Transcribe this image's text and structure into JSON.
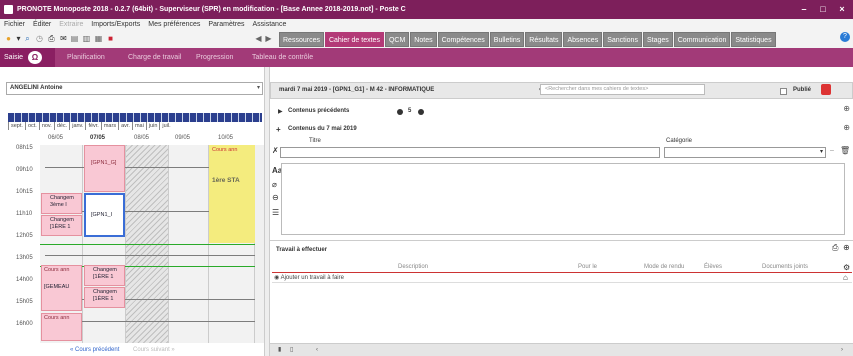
{
  "window": {
    "title": "PRONOTE Monoposte 2018 - 0.2.7 (64bit) - Superviseur (SPR) en modification - [Base Annee 2018-2019.not] - Poste C",
    "controls": [
      "–",
      "□",
      "×"
    ]
  },
  "menu": [
    {
      "label": "Fichier",
      "enabled": true
    },
    {
      "label": "Éditer",
      "enabled": true
    },
    {
      "label": "Extraire",
      "enabled": false
    },
    {
      "label": "Imports/Exports",
      "enabled": true
    },
    {
      "label": "Mes préférences",
      "enabled": true
    },
    {
      "label": "Paramètres",
      "enabled": true
    },
    {
      "label": "Assistance",
      "enabled": true
    }
  ],
  "tabs": [
    {
      "label": "Ressources",
      "active": false
    },
    {
      "label": "Cahier de textes",
      "active": true
    },
    {
      "label": "QCM",
      "active": false
    },
    {
      "label": "Notes",
      "active": false
    },
    {
      "label": "Compétences",
      "active": false
    },
    {
      "label": "Bulletins",
      "active": false
    },
    {
      "label": "Résultats",
      "active": false
    },
    {
      "label": "Absences",
      "active": false
    },
    {
      "label": "Sanctions",
      "active": false
    },
    {
      "label": "Stages",
      "active": false
    },
    {
      "label": "Communication",
      "active": false
    },
    {
      "label": "Statistiques",
      "active": false
    }
  ],
  "subtabs": {
    "saisie": "Saisie",
    "items": [
      "Planification",
      "Charge de travail",
      "Progression",
      "Tableau de contrôle"
    ]
  },
  "left": {
    "teacher": "ANGELINI Antoine",
    "months": [
      "sept.",
      "oct.",
      "nov.",
      "déc.",
      "janv.",
      "févr.",
      "mars",
      "avr.",
      "mai",
      "juin",
      "juil."
    ],
    "days": [
      "06/05",
      "07/05",
      "08/05",
      "09/05",
      "10/05"
    ],
    "hours": [
      "08h15",
      "09h10",
      "10h15",
      "11h10",
      "12h05",
      "13h05",
      "14h00",
      "15h05",
      "16h00"
    ],
    "blocks": {
      "b1": "[GPN1_G]",
      "b2": "Cours ann",
      "b3": "1ère STA",
      "b4": "Changem",
      "b4b": "3ème I",
      "b5": "Changem",
      "b5b": "[1ÈRE 1",
      "b6": "[GPN1_I",
      "b7": "Cours ann",
      "b8": "[GEMEAU",
      "b9": "Changem",
      "b9b": "[1ÈRE 1",
      "b10": "Changem",
      "b10b": "[1ÈRE 1",
      "b11": "Cours ann"
    },
    "nav_prev": "« Cours précédent",
    "nav_next": "Cours suivant »"
  },
  "right": {
    "course_header": "mardi 7 mai 2019 - [GPN1_G1] - M 42 - INFORMATIQUE",
    "search_placeholder": "<Rechercher dans mes cahiers de textes>",
    "publie": "Publié",
    "contenus_prec": "Contenus précédents",
    "contenus_count": "5",
    "contenus_du": "Contenus du 7 mai 2019",
    "titre_label": "Titre",
    "categorie_label": "Catégorie",
    "travail_title": "Travail à effectuer",
    "table_headers": [
      "Description",
      "Pour le",
      "Mode de rendu",
      "Élèves",
      "Documents joints"
    ],
    "add_work": "Ajouter un travail à faire"
  }
}
